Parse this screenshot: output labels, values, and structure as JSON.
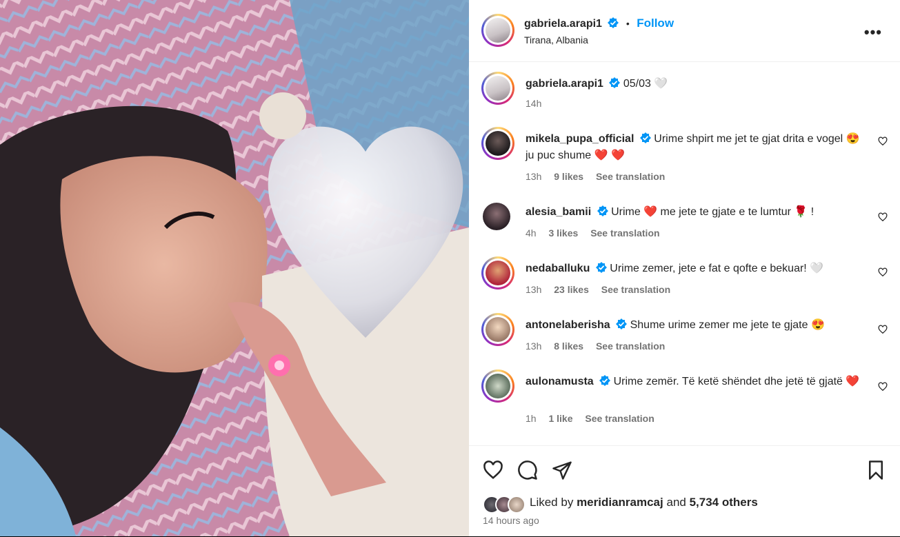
{
  "post": {
    "author": "gabriela.arapi1",
    "location": "Tirana, Albania",
    "follow_label": "Follow",
    "separator": "•",
    "caption": "05/03",
    "caption_time": "14h"
  },
  "comments": [
    {
      "user": "mikela_pupa_official",
      "text": "Urime shpirt me jet te gjat drita e vogel 😍 ju puc shume ❤️ ❤️",
      "time": "13h",
      "likes": "9 likes",
      "translate": "See translation"
    },
    {
      "user": "alesia_bamii",
      "text": "Urime ❤️ me jete te gjate e te lumtur 🌹 !",
      "time": "4h",
      "likes": "3 likes",
      "translate": "See translation"
    },
    {
      "user": "nedaballuku",
      "text": "Urime zemer, jete e fat e qofte e bekuar! 🤍",
      "time": "13h",
      "likes": "23 likes",
      "translate": "See translation"
    },
    {
      "user": "antonelaberisha",
      "text": "Shume urime zemer me jete te gjate 😍",
      "time": "13h",
      "likes": "8 likes",
      "translate": "See translation"
    },
    {
      "user": "aulonamusta",
      "text": "Urime zemër. Të ketë shëndet dhe jetë të gjatë ❤️",
      "time": "1h",
      "likes": "1 like",
      "translate": "See translation"
    }
  ],
  "footer": {
    "liked_prefix": "Liked by",
    "liked_user": "meridianramcaj",
    "liked_and": "and",
    "liked_count": "5,734 others",
    "time_ago": "14 hours ago"
  },
  "colors": {
    "accent": "#0095f6",
    "verified": "#0095f6",
    "text": "#262626",
    "muted": "#737373"
  },
  "icons": [
    "verified-badge-icon",
    "more-options-icon",
    "heart-icon",
    "comment-icon",
    "share-icon",
    "save-icon"
  ]
}
